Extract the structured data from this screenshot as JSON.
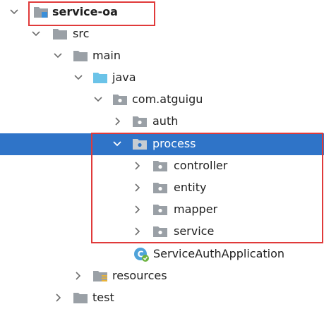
{
  "tree": {
    "module": {
      "label": "service-oa"
    },
    "src": {
      "label": "src"
    },
    "main": {
      "label": "main"
    },
    "java": {
      "label": "java"
    },
    "package": {
      "label": "com.atguigu"
    },
    "auth": {
      "label": "auth"
    },
    "process": {
      "label": "process"
    },
    "controller": {
      "label": "controller"
    },
    "entity": {
      "label": "entity"
    },
    "mapper": {
      "label": "mapper"
    },
    "service": {
      "label": "service"
    },
    "app_class": {
      "label": "ServiceAuthApplication"
    },
    "resources": {
      "label": "resources"
    },
    "test": {
      "label": "test"
    }
  },
  "colors": {
    "selection": "#2f74c8",
    "highlight_border": "#e03a3a",
    "folder_gray": "#9aa0a6",
    "folder_blue": "#6bc3e8"
  },
  "icons": {
    "expanded": "chevron-down-icon",
    "collapsed": "chevron-right-icon",
    "folder": "folder-icon",
    "package": "package-folder-icon",
    "source_root": "source-root-folder-icon",
    "module": "module-folder-icon",
    "resources": "resources-folder-icon",
    "spring_class": "spring-boot-class-icon"
  }
}
